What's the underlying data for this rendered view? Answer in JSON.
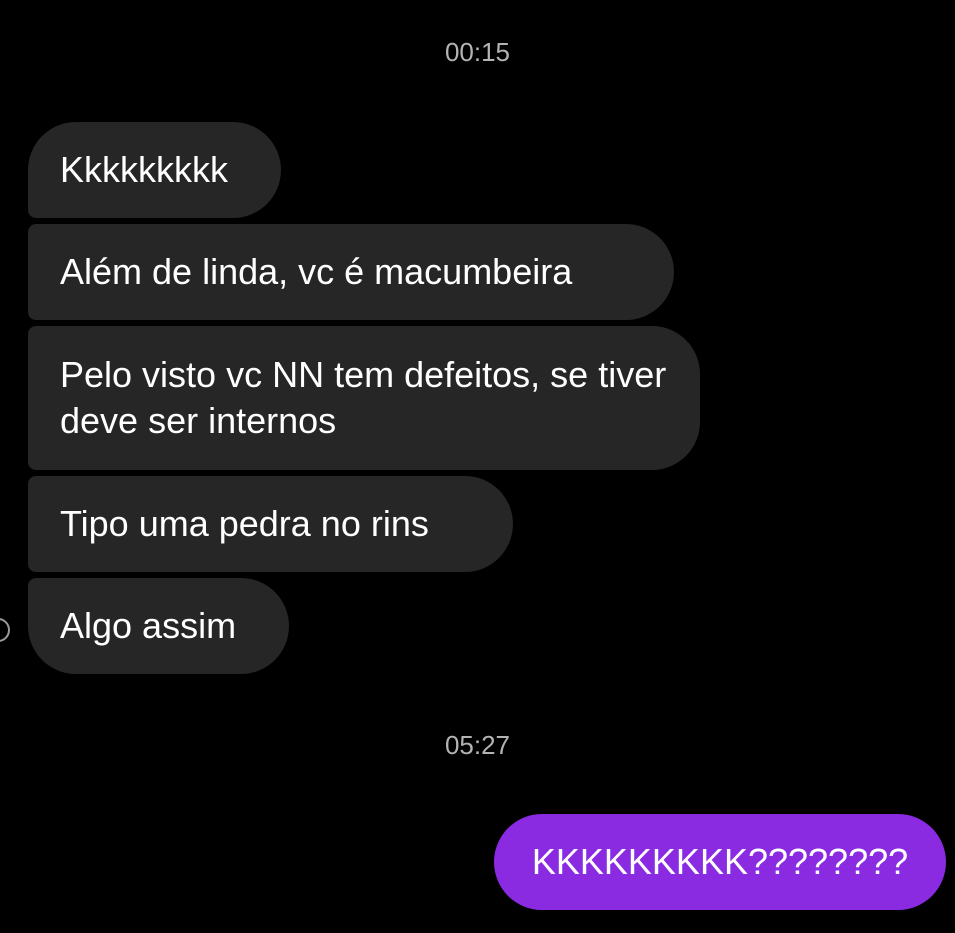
{
  "colors": {
    "background": "#000000",
    "received_bubble": "#262626",
    "sent_bubble": "#8a2be2",
    "timestamp": "#b3b3b3"
  },
  "conversation": {
    "timestamps": [
      "00:15",
      "05:27"
    ],
    "received_messages": [
      {
        "text": "Kkkkkkkkk"
      },
      {
        "text": "Além de linda, vc é macumbeira"
      },
      {
        "text": "Pelo visto vc NN tem defeitos, se tiver deve ser internos"
      },
      {
        "text": "Tipo uma pedra no rins"
      },
      {
        "text": "Algo assim"
      }
    ],
    "sent_messages": [
      {
        "text": "KKKKKKKKK????????"
      }
    ]
  }
}
